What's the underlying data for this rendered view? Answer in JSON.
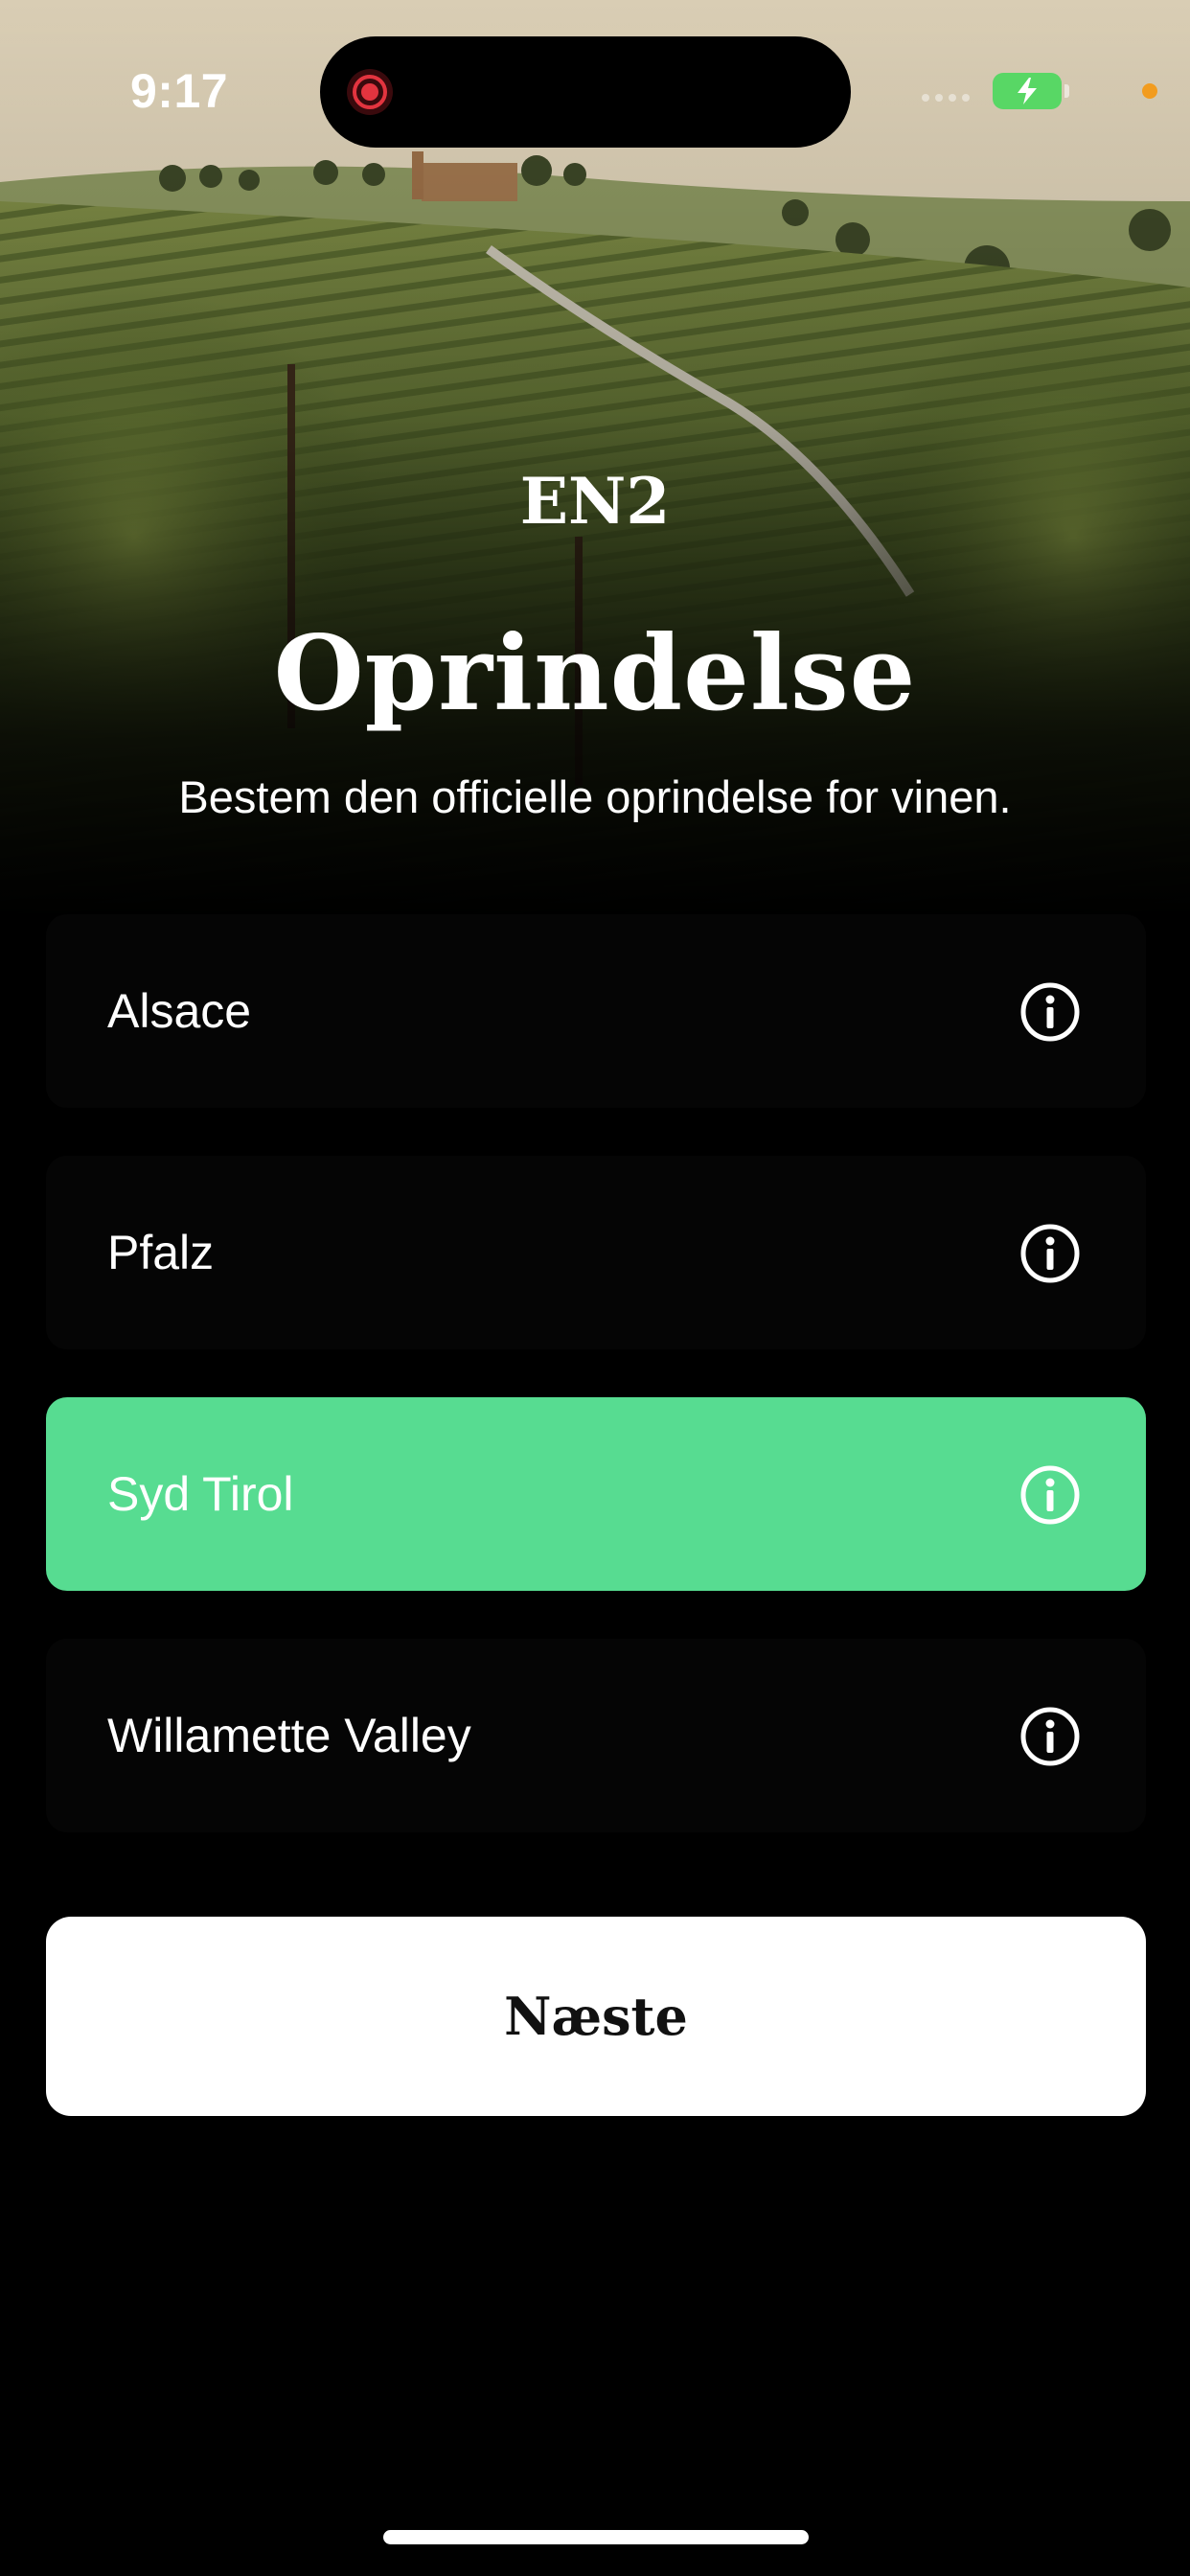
{
  "status_bar": {
    "time": "9:17"
  },
  "header": {
    "logo": "EN2",
    "title": "Oprindelse",
    "subtitle": "Bestem den officielle oprindelse for vinen."
  },
  "options": [
    {
      "label": "Alsace",
      "selected": false
    },
    {
      "label": "Pfalz",
      "selected": false
    },
    {
      "label": "Syd Tirol",
      "selected": true
    },
    {
      "label": "Willamette Valley",
      "selected": false
    }
  ],
  "next_button": {
    "label": "Næste"
  },
  "colors": {
    "selected": "#57dc91",
    "background": "#000000",
    "battery": "#58d765"
  },
  "icons": {
    "info": "info-icon",
    "battery": "battery-icon",
    "recording": "recording-icon"
  }
}
